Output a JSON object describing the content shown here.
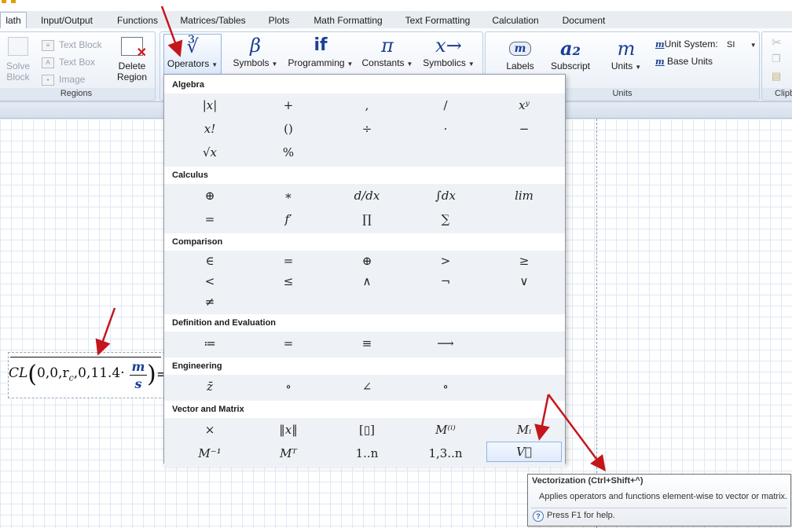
{
  "tabs": [
    {
      "label": "lath",
      "active": true
    },
    {
      "label": "Input/Output"
    },
    {
      "label": "Functions"
    },
    {
      "label": "Matrices/Tables"
    },
    {
      "label": "Plots"
    },
    {
      "label": "Math Formatting"
    },
    {
      "label": "Text Formatting"
    },
    {
      "label": "Calculation"
    },
    {
      "label": "Document"
    }
  ],
  "ribbon": {
    "regions": {
      "label": "Regions",
      "solve_block": "Solve\nBlock",
      "text_block": "Text Block",
      "text_box": "Text Box",
      "image": "Image",
      "delete_region": "Delete\nRegion"
    },
    "operators": {
      "label": "Operators",
      "glyph": "∛"
    },
    "symbols": {
      "label": "Symbols",
      "glyph": "β"
    },
    "programming": {
      "label": "Programming",
      "glyph": "if"
    },
    "constants": {
      "label": "Constants",
      "glyph": "π"
    },
    "symbolics": {
      "label": "Symbolics",
      "glyph": "x→"
    },
    "labels": {
      "label": "Labels",
      "glyph": "m"
    },
    "subscript": {
      "label": "Subscript",
      "glyph": "a₂"
    },
    "units_group": {
      "label": "Units",
      "units": "Units",
      "units_glyph": "m",
      "unit_system_label": "Unit System:",
      "unit_system_value": "SI",
      "base_units": "Base Units"
    },
    "clipboard": {
      "label": "Clipb"
    }
  },
  "panel": {
    "sections": [
      {
        "title": "Algebra",
        "rows": [
          [
            "|x|",
            "+",
            ",",
            "/",
            "xʸ"
          ],
          [
            "x!",
            "()",
            "÷",
            "·",
            "−"
          ],
          [
            "√x",
            "%"
          ]
        ]
      },
      {
        "title": "Calculus",
        "rows": [
          [
            "⊕",
            "∗",
            "d/dx",
            "∫dx",
            "lim"
          ],
          [
            "=",
            "f′",
            "∏",
            "∑"
          ]
        ]
      },
      {
        "title": "Comparison",
        "rows": [
          [
            "∈",
            "=",
            "⊕",
            ">",
            "≥"
          ],
          [
            "<",
            "≤",
            "∧",
            "¬",
            "∨"
          ],
          [
            "≠"
          ]
        ]
      },
      {
        "title": "Definition and Evaluation",
        "rows": [
          [
            "≔",
            "=",
            "≡",
            "⟶"
          ]
        ]
      },
      {
        "title": "Engineering",
        "rows": [
          [
            "z̄",
            "∘",
            "∠",
            "∘"
          ]
        ]
      },
      {
        "title": "Vector and Matrix",
        "rows": [
          [
            "×",
            "‖x‖",
            "[▯]",
            "M⁽ⁱ⁾",
            "Mᵢ"
          ],
          [
            "M⁻¹",
            "Mᵀ",
            "1..n",
            "1,3..n",
            "V⃗"
          ]
        ]
      }
    ],
    "selected": "V⃗"
  },
  "worksheet": {
    "expression": {
      "func": "CL",
      "args": "0,0,r",
      "sub": "c",
      "rest": ",0,11.4·",
      "unit_num": "m",
      "unit_den": "s",
      "equals": "="
    }
  },
  "tooltip": {
    "title": "Vectorization (Ctrl+Shift+^)",
    "body": "Applies operators and functions element-wise to vector or matrix.",
    "help": "Press F1 for help."
  },
  "colors": {
    "accent_blue": "#1c3f94",
    "arrow_red": "#c4161c",
    "tab_bg": "#e9edf2"
  }
}
